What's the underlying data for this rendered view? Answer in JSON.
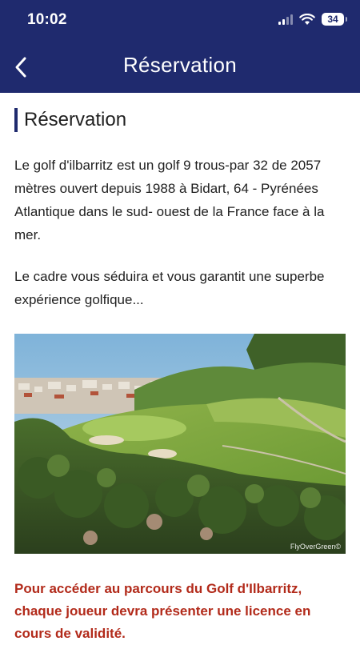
{
  "status_bar": {
    "time": "10:02",
    "battery": "34"
  },
  "header": {
    "title": "Réservation",
    "back_icon": "chevron-left-icon",
    "background_color": "#1f2a6e"
  },
  "content": {
    "heading": "Réservation",
    "paragraph_1": "Le golf d'ilbarritz est un golf 9 trous-par 32 de 2057 mètres ouvert depuis 1988 à Bidart, 64 - Pyrénées Atlantique dans le sud- ouest de la France face à la mer.",
    "paragraph_2": "Le cadre vous séduira et vous garantit une superbe expérience golfique...",
    "photo_watermark": "FlyOverGreen©",
    "notice": "Pour accéder au parcours du Golf d'Ilbarritz, chaque joueur devra présenter une licence en cours de validité.",
    "notice_color": "#b22a1a"
  }
}
